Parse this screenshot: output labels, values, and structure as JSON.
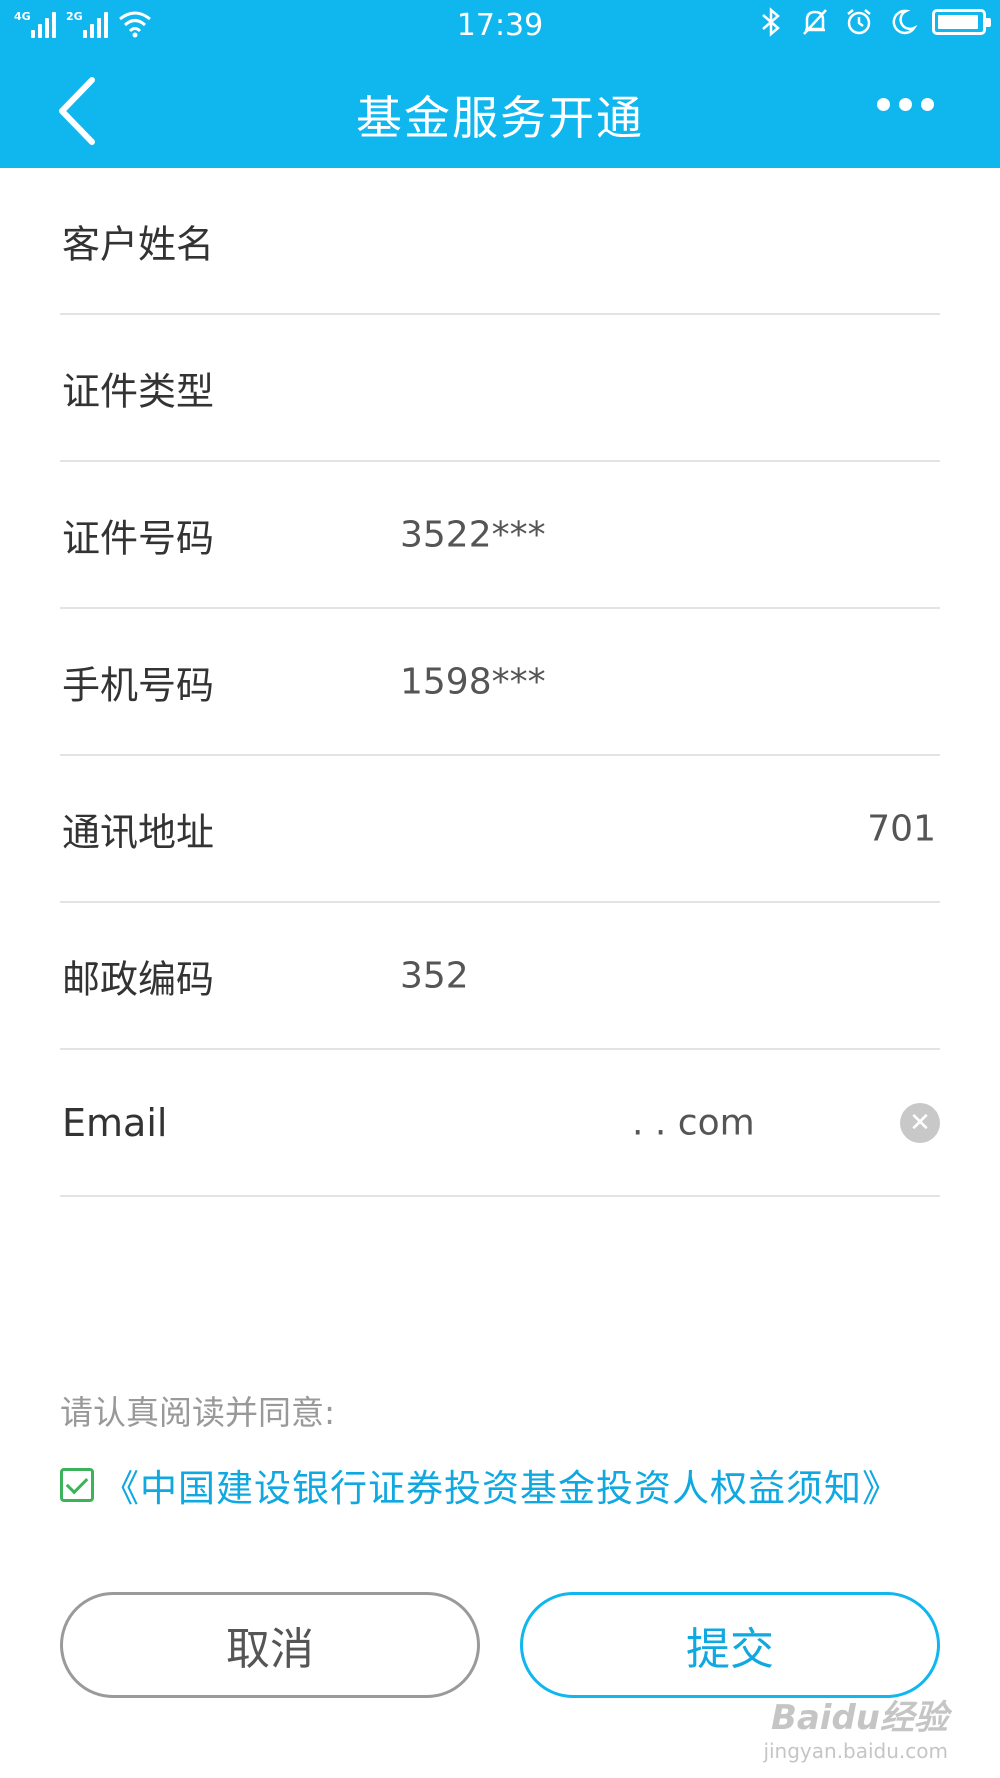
{
  "status_bar": {
    "signal1_label": "4G",
    "signal2_label": "2G",
    "time": "17:39"
  },
  "navbar": {
    "title": "基金服务开通"
  },
  "form": {
    "fields": [
      {
        "label": "客户姓名",
        "value": ""
      },
      {
        "label": "证件类型",
        "value": ""
      },
      {
        "label": "证件号码",
        "value": "3522***"
      },
      {
        "label": "手机号码",
        "value": "1598***"
      },
      {
        "label": "通讯地址",
        "value": "701"
      },
      {
        "label": "邮政编码",
        "value": "352"
      },
      {
        "label": "Email",
        "value": ". . com"
      }
    ]
  },
  "agreement": {
    "hint": "请认真阅读并同意:",
    "link_text": "《中国建设银行证券投资基金投资人权益须知》",
    "checked": true
  },
  "buttons": {
    "cancel": "取消",
    "submit": "提交"
  },
  "watermark": {
    "main": "Baidu经验",
    "sub": "jingyan.baidu.com"
  },
  "colors": {
    "header": "#10b6ee",
    "link": "#10a8e0",
    "checkbox": "#3cb35a"
  }
}
